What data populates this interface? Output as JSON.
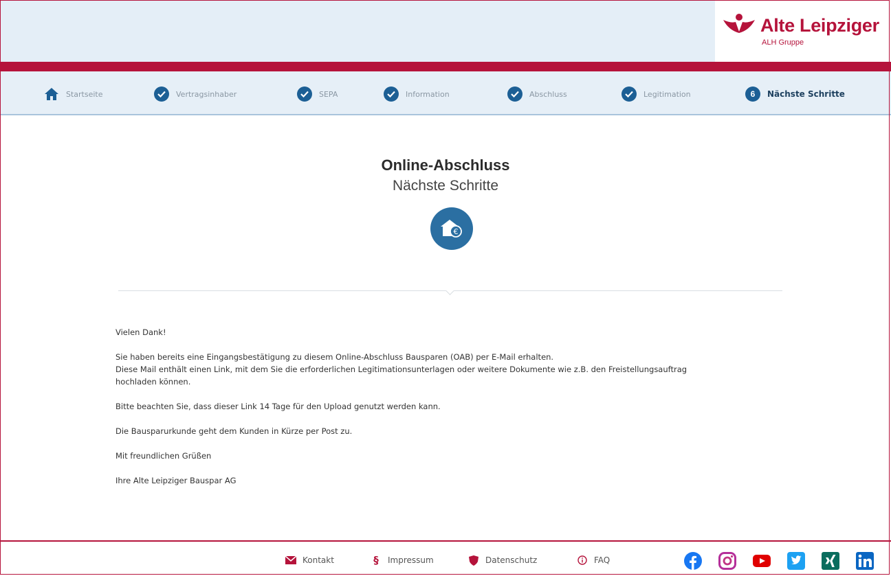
{
  "brand": {
    "name": "Alte Leipziger",
    "group": "ALH Gruppe",
    "accent": "#b5133b",
    "navy": "#1c5f95"
  },
  "steps": [
    {
      "label": "Startseite",
      "icon": "home-icon"
    },
    {
      "label": "Vertragsinhaber",
      "icon": "check-icon"
    },
    {
      "label": "SEPA",
      "icon": "check-icon"
    },
    {
      "label": "Information",
      "icon": "check-icon"
    },
    {
      "label": "Abschluss",
      "icon": "check-icon"
    },
    {
      "label": "Legitimation",
      "icon": "check-icon"
    },
    {
      "label": "Nächste Schritte",
      "number": "6",
      "active": true
    }
  ],
  "main": {
    "title": "Online-Abschluss",
    "subtitle": "Nächste Schritte",
    "badge_icon": "house-euro-icon",
    "paragraphs": [
      "Vielen Dank!",
      "Sie haben bereits eine Eingangsbestätigung zu diesem Online-Abschluss Bausparen (OAB) per E-Mail erhalten.",
      "Diese Mail enthält einen Link, mit dem Sie die erforderlichen Legitimationsunterlagen oder weitere Dokumente wie z.B. den Freistellungsauftrag hochladen können.",
      "Bitte beachten Sie, dass dieser Link 14 Tage für den Upload genutzt werden kann.",
      "Die Bausparurkunde geht dem Kunden in Kürze per Post zu.",
      "Mit freundlichen Grüßen",
      "Ihre Alte Leipziger Bauspar AG"
    ]
  },
  "footer": {
    "links": [
      {
        "label": "Kontakt",
        "icon": "envelope-icon"
      },
      {
        "label": "Impressum",
        "icon": "paragraph-icon"
      },
      {
        "label": "Datenschutz",
        "icon": "shield-icon"
      },
      {
        "label": "FAQ",
        "icon": "info-icon"
      }
    ],
    "social": [
      "facebook-icon",
      "instagram-icon",
      "youtube-icon",
      "twitter-icon",
      "xing-icon",
      "linkedin-icon"
    ]
  }
}
